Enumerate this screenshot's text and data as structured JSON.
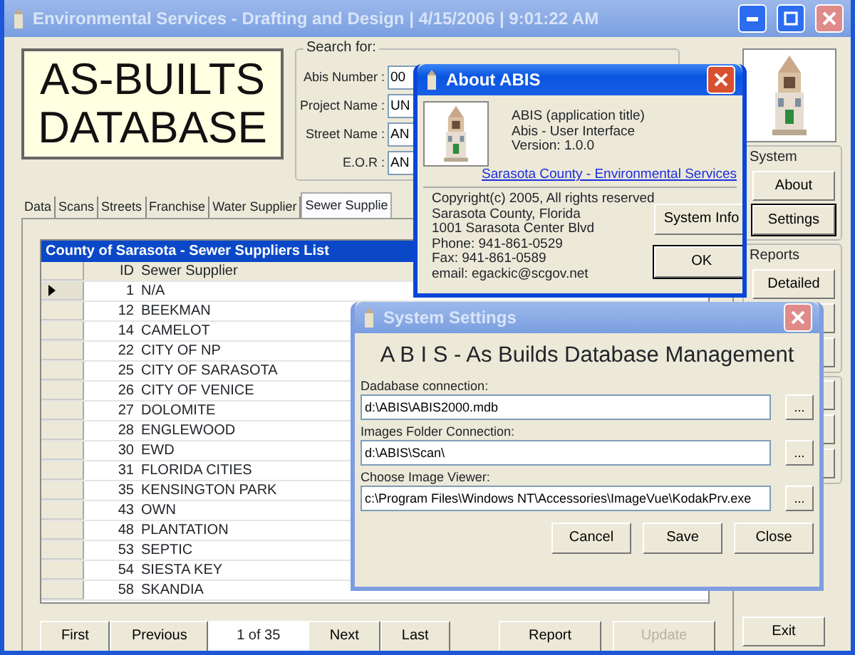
{
  "window": {
    "title": "Environmental Services - Drafting and Design | 4/15/2006 | 9:01:22 AM"
  },
  "logo": {
    "lines": [
      "AS-BUILTS",
      "DATABASE"
    ]
  },
  "search": {
    "legend": "Search for:",
    "fields": [
      {
        "label": "Abis Number :",
        "value": "00"
      },
      {
        "label": "Project Name :",
        "value": "UN"
      },
      {
        "label": "Street Name :",
        "value": "AN"
      },
      {
        "label": "E.O.R :",
        "value": "AN"
      }
    ]
  },
  "tabs": [
    {
      "label": "Data",
      "selected": false
    },
    {
      "label": "Scans",
      "selected": false
    },
    {
      "label": "Streets",
      "selected": false
    },
    {
      "label": "Franchise",
      "selected": false
    },
    {
      "label": "Water Supplier",
      "selected": false
    },
    {
      "label": "Sewer Supplie",
      "selected": true
    }
  ],
  "grid": {
    "caption": "County of Sarasota - Sewer Suppliers List",
    "columns": [
      "ID",
      "Sewer Supplier"
    ],
    "rows": [
      {
        "id": "1",
        "name": "N/A",
        "selected": true
      },
      {
        "id": "12",
        "name": "BEEKMAN",
        "selected": false
      },
      {
        "id": "14",
        "name": "CAMELOT",
        "selected": false
      },
      {
        "id": "22",
        "name": "CITY OF NP",
        "selected": false
      },
      {
        "id": "25",
        "name": "CITY OF SARASOTA",
        "selected": false
      },
      {
        "id": "26",
        "name": "CITY OF VENICE",
        "selected": false
      },
      {
        "id": "27",
        "name": "DOLOMITE",
        "selected": false
      },
      {
        "id": "28",
        "name": "ENGLEWOOD",
        "selected": false
      },
      {
        "id": "30",
        "name": "EWD",
        "selected": false
      },
      {
        "id": "31",
        "name": "FLORIDA CITIES",
        "selected": false
      },
      {
        "id": "35",
        "name": "KENSINGTON PARK",
        "selected": false
      },
      {
        "id": "43",
        "name": "OWN",
        "selected": false
      },
      {
        "id": "48",
        "name": "PLANTATION",
        "selected": false
      },
      {
        "id": "53",
        "name": "SEPTIC",
        "selected": false
      },
      {
        "id": "54",
        "name": "SIESTA KEY",
        "selected": false
      },
      {
        "id": "58",
        "name": "SKANDIA",
        "selected": false
      }
    ]
  },
  "pager": [
    {
      "kind": "button",
      "label": "First"
    },
    {
      "kind": "button",
      "label": "Previous"
    },
    {
      "kind": "position",
      "label": "1 of 35"
    },
    {
      "kind": "button",
      "label": "Next"
    },
    {
      "kind": "button",
      "label": "Last"
    }
  ],
  "actions": [
    {
      "label": "Report",
      "disabled": false
    },
    {
      "label": "Update",
      "disabled": true
    }
  ],
  "side": {
    "groups": [
      {
        "title": "System",
        "buttons": [
          {
            "kind": "button",
            "label": "About",
            "default": false
          },
          {
            "kind": "button",
            "label": "Settings",
            "default": true
          }
        ]
      },
      {
        "title": "Reports",
        "buttons": [
          {
            "kind": "button",
            "label": "Detailed",
            "default": false
          },
          {
            "kind": "covered"
          },
          {
            "kind": "covered"
          }
        ]
      },
      {
        "buttons": [
          {
            "kind": "covered"
          },
          {
            "kind": "covered"
          },
          {
            "kind": "covered"
          }
        ]
      }
    ],
    "exit": "Exit"
  },
  "about": {
    "title": "About ABIS",
    "active": true,
    "lines": [
      "ABIS (application title)",
      "Abis - User Interface",
      "Version: 1.0.0"
    ],
    "link": "Sarasota County - Environmental Services",
    "details": [
      "Copyright(c) 2005, All rights reserved",
      "Sarasota County, Florida",
      "1001 Sarasota Center Blvd",
      "Phone: 941-861-0529",
      "Fax: 941-861-0589",
      "email: egackic@scgov.net"
    ],
    "buttons": [
      {
        "label": "System Info",
        "default": false
      },
      {
        "label": "OK",
        "default": true
      }
    ]
  },
  "settings": {
    "title": "System Settings",
    "active": false,
    "heading": "A B I S - As Builds Database Management",
    "fields": [
      {
        "label": "Dadabase connection:",
        "value": "d:\\ABIS\\ABIS2000.mdb",
        "browse": "..."
      },
      {
        "label": "Images Folder Connection:",
        "value": "d:\\ABIS\\Scan\\",
        "browse": "..."
      },
      {
        "label": "Choose Image Viewer:",
        "value": "c:\\Program Files\\Windows NT\\Accessories\\ImageVue\\KodakPrv.exe",
        "browse": "..."
      }
    ],
    "buttons": [
      {
        "label": "Cancel"
      },
      {
        "label": "Save"
      },
      {
        "label": "Close"
      }
    ]
  }
}
